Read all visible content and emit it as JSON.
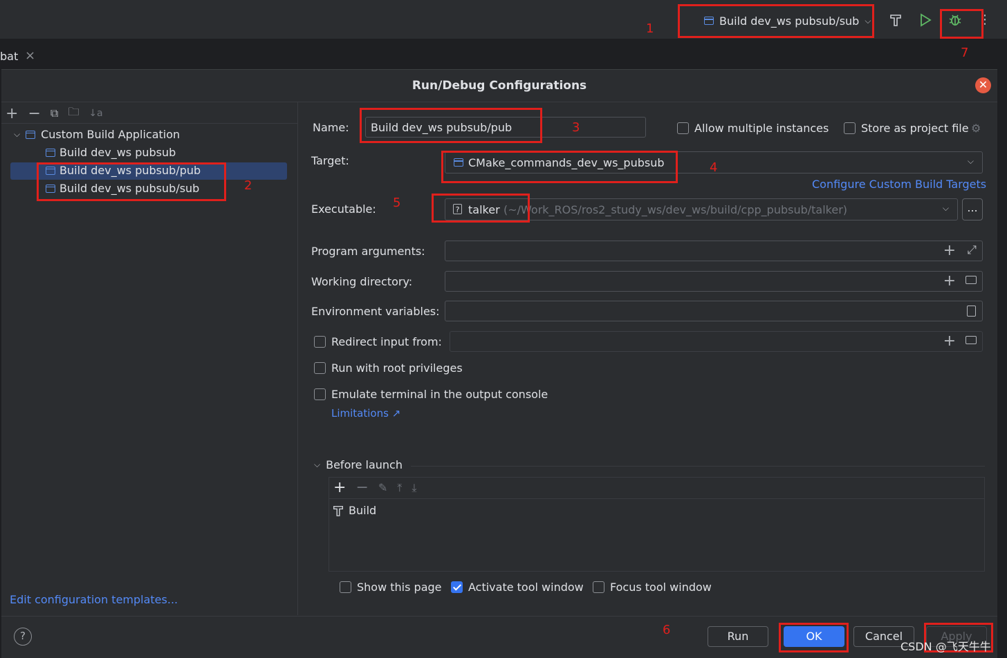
{
  "toolbar": {
    "run_config": "Build dev_ws pubsub/sub",
    "tab_label": "bat",
    "tab_close": "×",
    "more": "⋮"
  },
  "dialog": {
    "title": "Run/Debug Configurations",
    "tree": {
      "group": "Custom Build Application",
      "items": [
        "Build dev_ws pubsub",
        "Build dev_ws pubsub/pub",
        "Build dev_ws pubsub/sub"
      ]
    },
    "edit_templates": "Edit configuration templates...",
    "help": "?",
    "form": {
      "name_label": "Name:",
      "name_value": "Build dev_ws pubsub/pub",
      "allow_multiple": "Allow multiple instances",
      "store_project": "Store as project file",
      "target_label": "Target:",
      "target_value": "CMake_commands_dev_ws_pubsub",
      "configure_targets": "Configure Custom Build Targets",
      "executable_label": "Executable:",
      "executable_value": "talker",
      "executable_path": "(~/Work_ROS/ros2_study_ws/dev_ws/build/cpp_pubsub/talker)",
      "browse": "...",
      "program_args_label": "Program arguments:",
      "working_dir_label": "Working directory:",
      "env_vars_label": "Environment variables:",
      "redirect_input": "Redirect input from:",
      "root_privileges": "Run with root privileges",
      "emulate_terminal": "Emulate terminal in the output console",
      "limitations": "Limitations ↗",
      "before_launch": "Before launch",
      "build_task": "Build",
      "show_page": "Show this page",
      "activate_window": "Activate tool window",
      "focus_window": "Focus tool window"
    },
    "buttons": {
      "run": "Run",
      "ok": "OK",
      "cancel": "Cancel",
      "apply": "Apply"
    }
  },
  "annotations": [
    "1",
    "2",
    "3",
    "4",
    "5",
    "6",
    "7"
  ],
  "watermark": "CSDN @飞天牛牛",
  "colors": {
    "annotation": "#e0201c",
    "accent": "#3574f0",
    "link": "#548af7",
    "selection": "#2e436e"
  }
}
